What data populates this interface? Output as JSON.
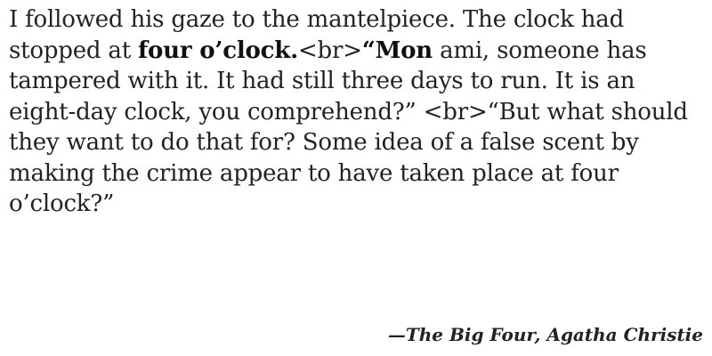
{
  "quote": {
    "segment_1": "I followed his gaze to the mantelpiece. The clock had stopped at ",
    "bold_1": "four o’clock.",
    "segment_2": "<br>",
    "bold_2": "“Mon",
    "segment_3": " ami, someone has tampered with it. It had still three days to run. It is an eight-day clock, you comprehend?” <br>“But what should they want to do that for? Some idea of a false scent by making the crime appear to have taken place at four o’clock?”"
  },
  "attribution": {
    "dash": "—",
    "work": "The Big Four",
    "separator": ", ",
    "author": "Agatha Christie"
  }
}
